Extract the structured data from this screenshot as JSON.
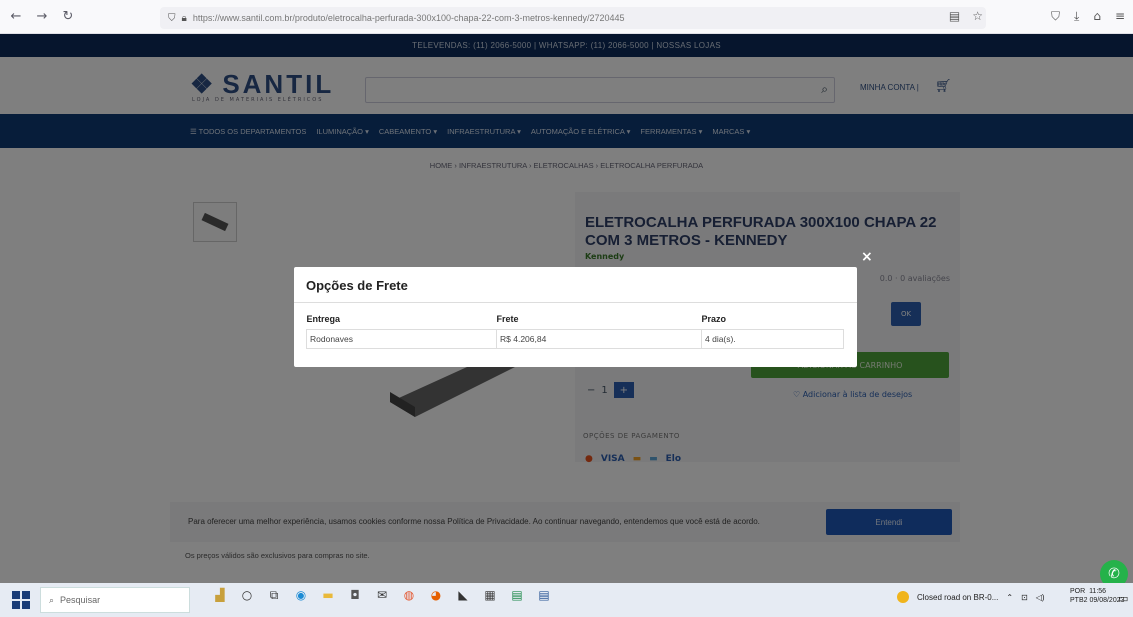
{
  "browser": {
    "url": "https://www.santil.com.br/produto/eletrocalha-perfurada-300x100-chapa-22-com-3-metros-kennedy/2720445",
    "url_domain": "santil.com.br"
  },
  "site": {
    "topbar_text": "TELEVENDAS: (11) 2066-5000 | WHATSAPP: (11) 2066-5000 | NOSSAS LOJAS",
    "logo": "SANTIL",
    "logo_sub": "LOJA DE MATERIAIS ELÉTRICOS",
    "header_links": "MINHA CONTA |",
    "menu": [
      "☰ TODOS OS DEPARTAMENTOS",
      "ILUMINAÇÃO ▾",
      "CABEAMENTO ▾",
      "INFRAESTRUTURA ▾",
      "AUTOMAÇÃO E ELÉTRICA ▾",
      "FERRAMENTAS ▾",
      "MARCAS ▾"
    ],
    "breadcrumb": "HOME › INFRAESTRUTURA › ELETROCALHAS › ELETROCALHA PERFURADA"
  },
  "product": {
    "title": "ELETROCALHA PERFURADA 300X100 CHAPA 22 COM 3 METROS - KENNEDY",
    "brand": "Kennedy",
    "rating": "0.0 · 0 avaliações",
    "cep_button": "OK",
    "buy_button": "ADICIONAR AO CARRINHO",
    "wishlist": "♡ Adicionar à lista de desejos",
    "payment_label": "OPÇÕES DE PAGAMENTO",
    "payment_methods": [
      "VISA",
      "Elo"
    ]
  },
  "cookie": {
    "text": "Para oferecer uma melhor experiência, usamos cookies conforme nossa Política de Privacidade. Ao continuar navegando, entendemos que você está de acordo.",
    "button": "Entendi"
  },
  "footer_text": "Os preços válidos são exclusivos para compras no site.",
  "modal": {
    "title": "Opções de Frete",
    "close": "×",
    "columns": [
      "Entrega",
      "Frete",
      "Prazo"
    ],
    "rows": [
      [
        "Rodonaves",
        "R$ 4.206,84",
        "4 dia(s)."
      ]
    ]
  },
  "taskbar": {
    "search_placeholder": "Pesquisar",
    "tray_text": "Closed road on BR-0...",
    "clock_lang": "POR",
    "clock_layout": "PTB2",
    "clock_time": "11:56",
    "clock_date": "09/08/2023"
  }
}
